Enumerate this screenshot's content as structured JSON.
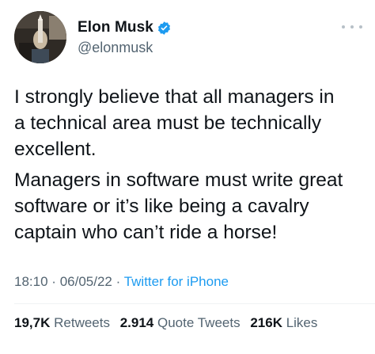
{
  "author": {
    "display_name": "Elon Musk",
    "handle": "@elonmusk",
    "verified": true
  },
  "tweet": {
    "paragraphs": [
      [
        "I strongly believe that all managers in",
        "a technical area must be technically",
        "excellent."
      ],
      [
        "Managers in software must write great",
        "software or it’s like being a cavalry",
        "captain who can’t ride a horse!"
      ]
    ],
    "time": "18:10",
    "separator": "·",
    "date": "06/05/22",
    "source": "Twitter for iPhone"
  },
  "stats": {
    "retweets_count": "19,7K",
    "retweets_label": "Retweets",
    "quotes_count": "2.914",
    "quotes_label": "Quote Tweets",
    "likes_count": "216K",
    "likes_label": "Likes"
  },
  "colors": {
    "accent": "#1d9bf0",
    "text": "#0f1419",
    "secondary": "#536471"
  },
  "icons": {
    "verified": "verified-badge-icon",
    "more": "more-options-icon"
  }
}
